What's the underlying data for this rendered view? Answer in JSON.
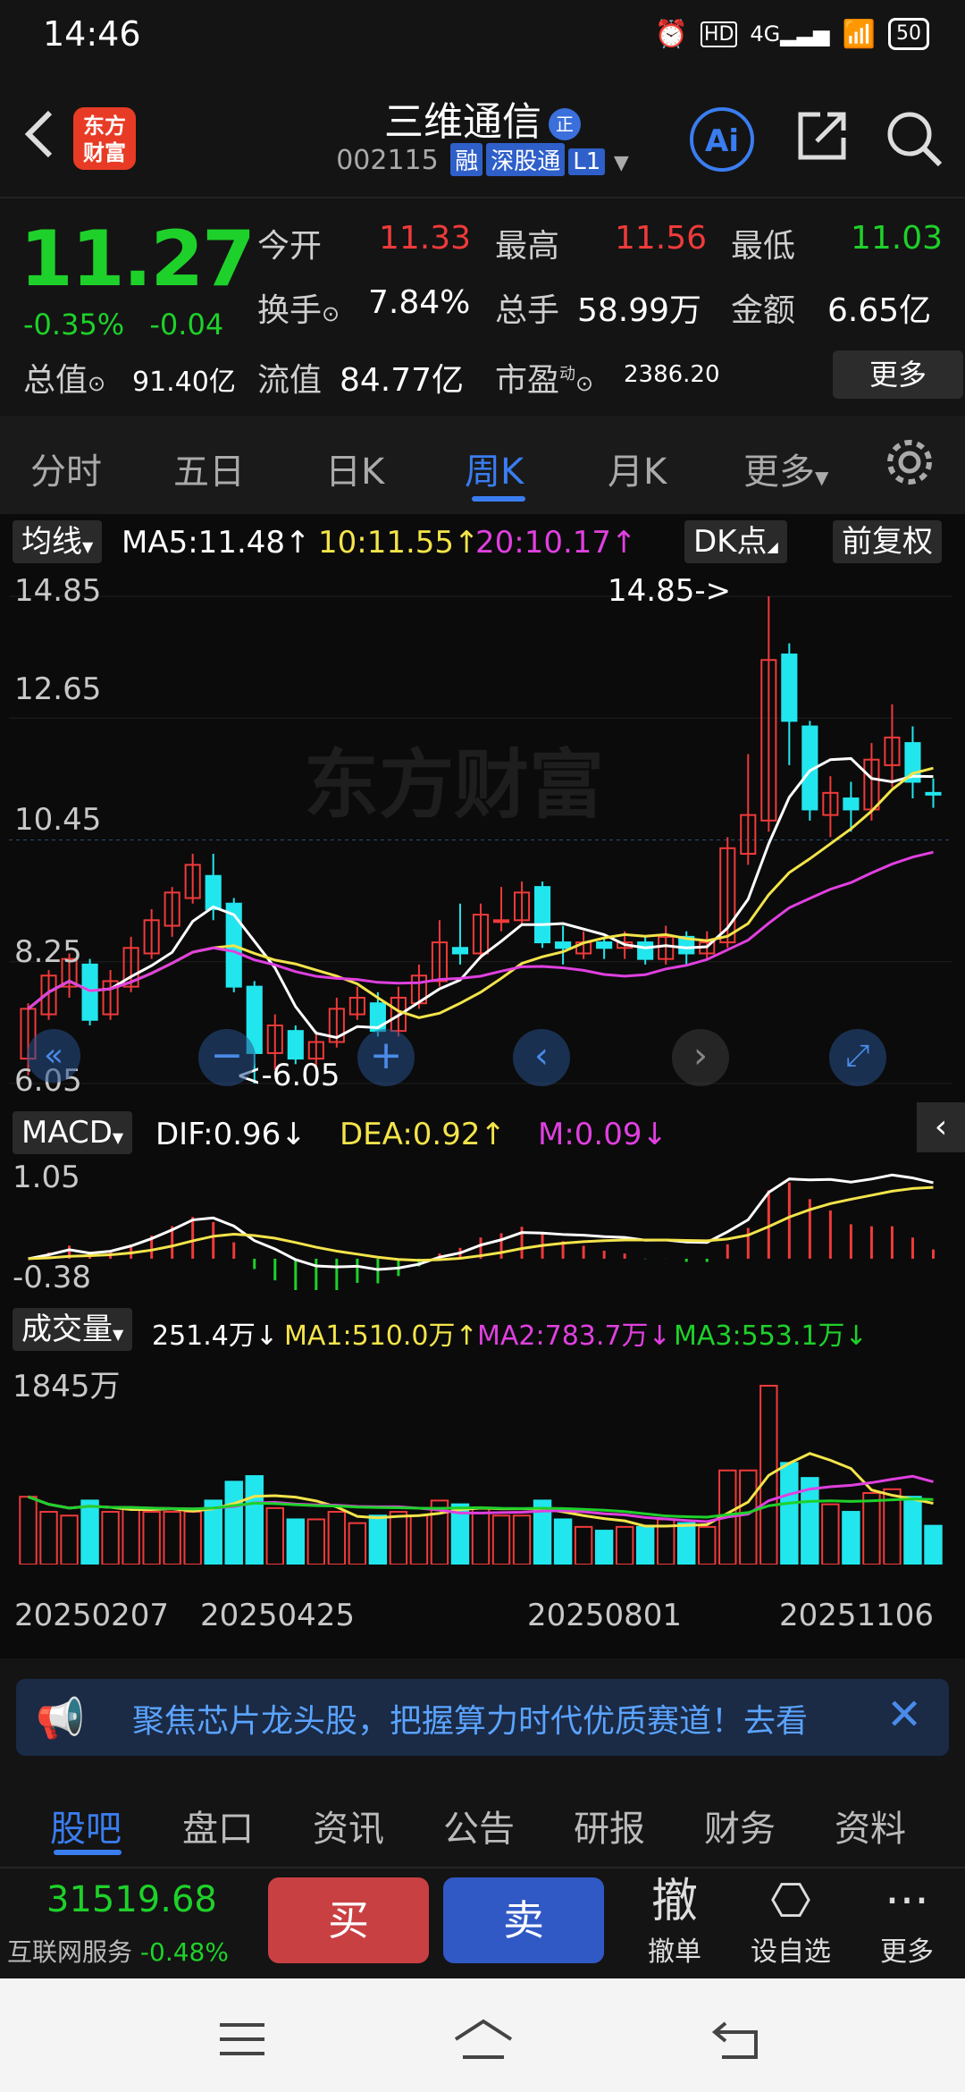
{
  "status": {
    "time": "14:46",
    "network": "4G",
    "battery": "50"
  },
  "header": {
    "app_logo": "东方财富",
    "stock_name": "三维通信",
    "badge": "正",
    "stock_code": "002115",
    "tags": [
      "融",
      "深股通",
      "L1"
    ],
    "ai_label": "Ai"
  },
  "quote": {
    "price": "11.27",
    "change_pct": "-0.35%",
    "change": "-0.04",
    "open_label": "今开",
    "open": "11.33",
    "high_label": "最高",
    "high": "11.56",
    "low_label": "最低",
    "low": "11.03",
    "turnover_label": "换手",
    "turnover": "7.84%",
    "volume_label": "总手",
    "volume": "58.99万",
    "amount_label": "金额",
    "amount": "6.65亿",
    "mktcap_label": "总值",
    "mktcap": "91.40亿",
    "float_label": "流值",
    "float_cap": "84.77亿",
    "pe_label": "市盈",
    "pe_sup": "动",
    "pe": "2386.20",
    "more": "更多"
  },
  "tabs": [
    {
      "label": "分时"
    },
    {
      "label": "五日"
    },
    {
      "label": "日K"
    },
    {
      "label": "周K"
    },
    {
      "label": "月K"
    },
    {
      "label": "更多"
    }
  ],
  "kline": {
    "indicator": "均线",
    "ma5": "MA5:11.48↑",
    "ma10": "10:11.55↑",
    "ma20": "20:10.17↑",
    "dk_button": "DK点",
    "adjust_button": "前复权",
    "y_ticks": [
      "14.85",
      "12.65",
      "10.45",
      "8.25",
      "6.05"
    ],
    "high_mark": "14.85->",
    "low_mark": "<-6.05",
    "watermark": "东方财富"
  },
  "macd": {
    "label": "MACD",
    "dif": "DIF:0.96↓",
    "dea": "DEA:0.92↑",
    "m": "M:0.09↓",
    "y_ticks": [
      "1.05",
      "-0.38"
    ]
  },
  "volume": {
    "label": "成交量",
    "vol": "251.4万↓",
    "ma1": "MA1:510.0万↑",
    "ma2": "MA2:783.7万↓",
    "ma3": "MA3:553.1万↓",
    "y_max": "1845万",
    "x_ticks": [
      "20250207",
      "20250425",
      "20250801",
      "20251106"
    ]
  },
  "chart_data": {
    "type": "candlestick",
    "candles": [
      {
        "o": 6.5,
        "c": 7.4,
        "h": 7.5,
        "l": 6.2
      },
      {
        "o": 7.3,
        "c": 8.0,
        "h": 8.1,
        "l": 7.2
      },
      {
        "o": 7.8,
        "c": 8.3,
        "h": 8.4,
        "l": 7.6
      },
      {
        "o": 8.2,
        "c": 7.2,
        "h": 8.3,
        "l": 7.1
      },
      {
        "o": 7.3,
        "c": 7.9,
        "h": 8.1,
        "l": 7.2
      },
      {
        "o": 7.8,
        "c": 8.5,
        "h": 8.7,
        "l": 7.7
      },
      {
        "o": 8.4,
        "c": 9.0,
        "h": 9.2,
        "l": 8.3
      },
      {
        "o": 8.9,
        "c": 9.5,
        "h": 9.6,
        "l": 8.7
      },
      {
        "o": 9.4,
        "c": 10.0,
        "h": 10.2,
        "l": 9.3
      },
      {
        "o": 9.8,
        "c": 9.2,
        "h": 10.2,
        "l": 9.0
      },
      {
        "o": 9.3,
        "c": 7.8,
        "h": 9.4,
        "l": 7.7
      },
      {
        "o": 7.8,
        "c": 6.6,
        "h": 7.9,
        "l": 6.05
      },
      {
        "o": 6.6,
        "c": 7.1,
        "h": 7.3,
        "l": 6.3
      },
      {
        "o": 7.0,
        "c": 6.5,
        "h": 7.1,
        "l": 6.4
      },
      {
        "o": 6.5,
        "c": 6.8,
        "h": 7.0,
        "l": 6.3
      },
      {
        "o": 6.8,
        "c": 7.4,
        "h": 7.6,
        "l": 6.7
      },
      {
        "o": 7.3,
        "c": 7.6,
        "h": 7.8,
        "l": 7.2
      },
      {
        "o": 7.5,
        "c": 7.0,
        "h": 7.7,
        "l": 6.9
      },
      {
        "o": 7.0,
        "c": 7.6,
        "h": 7.8,
        "l": 6.9
      },
      {
        "o": 7.5,
        "c": 8.0,
        "h": 8.2,
        "l": 7.4
      },
      {
        "o": 7.9,
        "c": 8.6,
        "h": 9.0,
        "l": 7.8
      },
      {
        "o": 8.5,
        "c": 8.4,
        "h": 9.3,
        "l": 8.2
      },
      {
        "o": 8.4,
        "c": 9.1,
        "h": 9.3,
        "l": 8.3
      },
      {
        "o": 9.0,
        "c": 9.0,
        "h": 9.6,
        "l": 8.8
      },
      {
        "o": 9.0,
        "c": 9.5,
        "h": 9.7,
        "l": 8.9
      },
      {
        "o": 9.6,
        "c": 8.6,
        "h": 9.7,
        "l": 8.5
      },
      {
        "o": 8.6,
        "c": 8.5,
        "h": 8.9,
        "l": 8.2
      },
      {
        "o": 8.4,
        "c": 8.6,
        "h": 8.8,
        "l": 8.3
      },
      {
        "o": 8.6,
        "c": 8.5,
        "h": 8.7,
        "l": 8.3
      },
      {
        "o": 8.5,
        "c": 8.6,
        "h": 8.8,
        "l": 8.3
      },
      {
        "o": 8.6,
        "c": 8.3,
        "h": 8.7,
        "l": 8.2
      },
      {
        "o": 8.3,
        "c": 8.7,
        "h": 8.9,
        "l": 8.2
      },
      {
        "o": 8.7,
        "c": 8.4,
        "h": 8.8,
        "l": 8.2
      },
      {
        "o": 8.4,
        "c": 8.6,
        "h": 8.8,
        "l": 8.3
      },
      {
        "o": 8.6,
        "c": 10.3,
        "h": 10.5,
        "l": 8.5
      },
      {
        "o": 10.2,
        "c": 10.9,
        "h": 12.0,
        "l": 10.0
      },
      {
        "o": 10.8,
        "c": 13.7,
        "h": 14.85,
        "l": 10.6
      },
      {
        "o": 13.8,
        "c": 12.6,
        "h": 14.0,
        "l": 11.8
      },
      {
        "o": 12.5,
        "c": 11.0,
        "h": 12.6,
        "l": 10.8
      },
      {
        "o": 10.9,
        "c": 11.3,
        "h": 11.6,
        "l": 10.5
      },
      {
        "o": 11.2,
        "c": 11.0,
        "h": 11.5,
        "l": 10.6
      },
      {
        "o": 11.0,
        "c": 11.9,
        "h": 12.2,
        "l": 10.8
      },
      {
        "o": 11.8,
        "c": 12.3,
        "h": 12.9,
        "l": 11.4
      },
      {
        "o": 12.2,
        "c": 11.5,
        "h": 12.5,
        "l": 11.2
      },
      {
        "o": 11.3,
        "c": 11.27,
        "h": 11.56,
        "l": 11.03
      }
    ],
    "ylim": [
      6.05,
      14.85
    ]
  }
}
